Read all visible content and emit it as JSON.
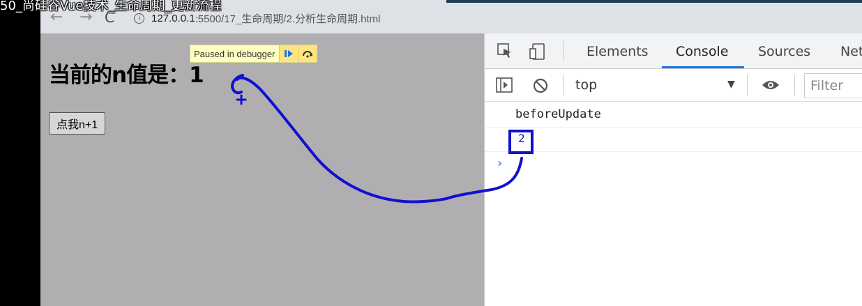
{
  "video_title": "50_尚硅谷Vue技术_生命周期_更新流程",
  "browser": {
    "back": "←",
    "forward": "→",
    "reload": "C",
    "url_host": "127.0.0.1",
    "url_rest": ":5500/17_生命周期/2.分析生命周期.html"
  },
  "page": {
    "paused_label": "Paused in debugger",
    "heading": "当前的n值是：1",
    "button_label": "点我n+1"
  },
  "devtools": {
    "tabs": [
      "Elements",
      "Console",
      "Sources",
      "Net"
    ],
    "active_tab": "Console",
    "context": "top",
    "filter_placeholder": "Filter",
    "console_lines": [
      "beforeUpdate",
      "2"
    ],
    "prompt": "›"
  },
  "colors": {
    "annotation": "#1010d0",
    "page_bg": "#b0aeb1",
    "accent": "#1a73e8"
  }
}
